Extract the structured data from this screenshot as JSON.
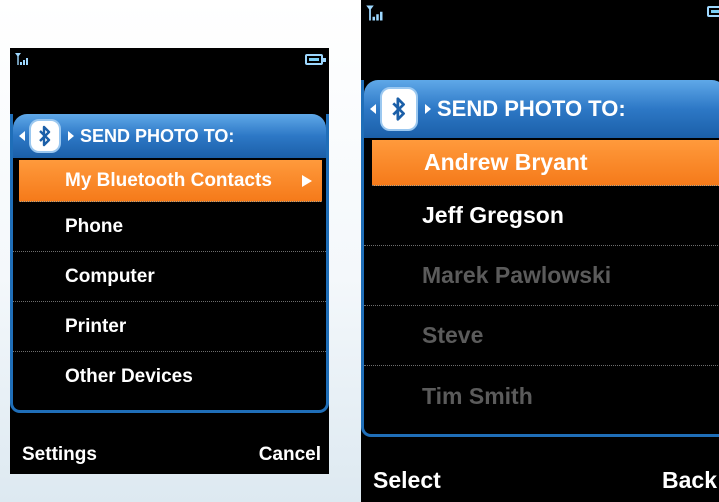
{
  "left_screen": {
    "header_title": "SEND PHOTO TO:",
    "items": [
      {
        "label": "My Bluetooth Contacts"
      },
      {
        "label": "Phone"
      },
      {
        "label": "Computer"
      },
      {
        "label": "Printer"
      },
      {
        "label": "Other Devices"
      }
    ],
    "softkey_left": "Settings",
    "softkey_right": "Cancel"
  },
  "right_screen": {
    "header_title": "SEND PHOTO TO:",
    "items": [
      {
        "label": "Andrew Bryant"
      },
      {
        "label": "Jeff Gregson"
      },
      {
        "label": "Marek Pawlowski"
      },
      {
        "label": "Steve"
      },
      {
        "label": "Tim Smith"
      }
    ],
    "softkey_left": "Select",
    "softkey_right": "Back"
  },
  "colors": {
    "header_blue": "#2d78c6",
    "selection_orange": "#f57a1a",
    "disabled_text": "#5b5b5b"
  },
  "icons": [
    "signal-icon",
    "battery-icon",
    "bluetooth-icon",
    "arrow-left-icon",
    "arrow-right-icon",
    "submenu-arrow-icon"
  ]
}
